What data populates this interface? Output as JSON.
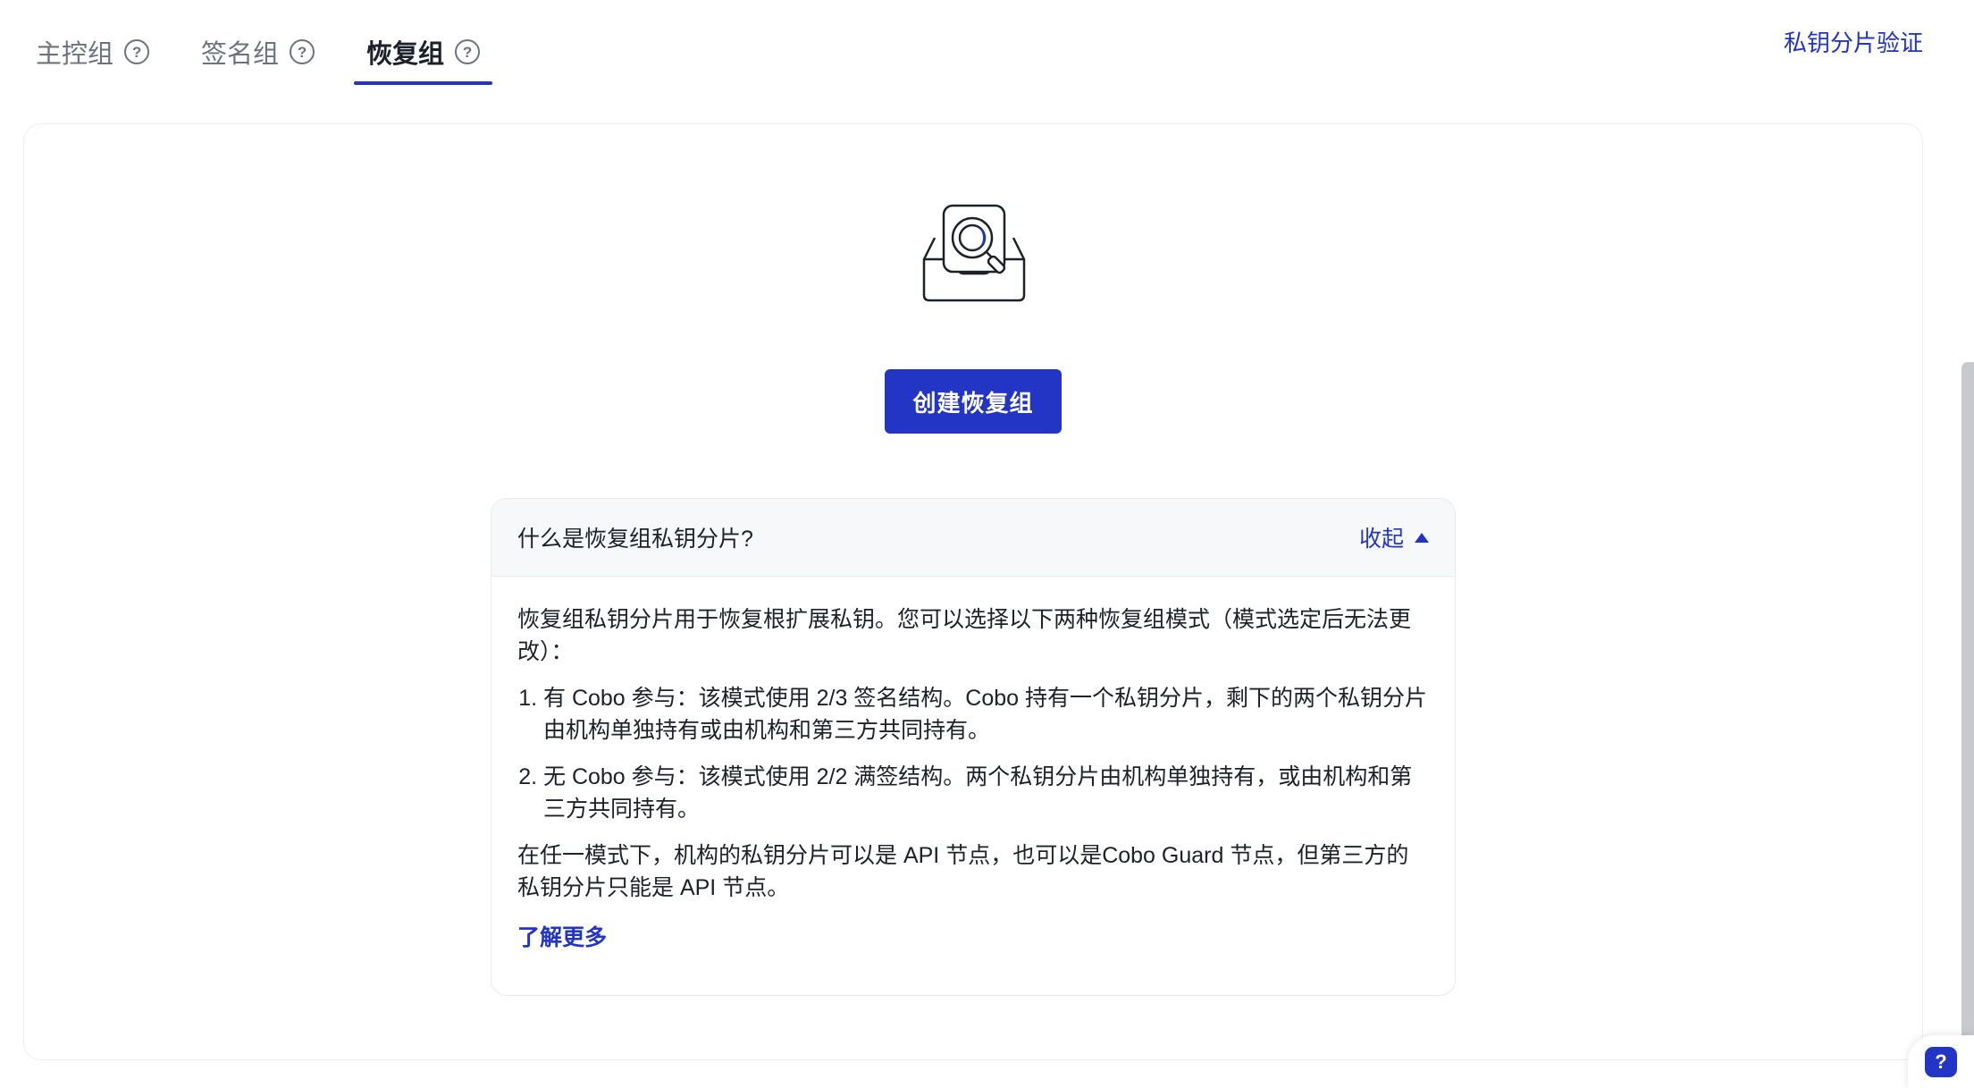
{
  "tabs": [
    {
      "label": "主控组",
      "active": false
    },
    {
      "label": "签名组",
      "active": false
    },
    {
      "label": "恢复组",
      "active": true
    }
  ],
  "help_glyph": "?",
  "top_link": "私钥分片验证",
  "create_button": "创建恢复组",
  "info": {
    "title": "什么是恢复组私钥分片?",
    "collapse_label": "收起",
    "intro": "恢复组私钥分片用于恢复根扩展私钥。您可以选择以下两种恢复组模式（模式选定后无法更改）：",
    "items": [
      "有 Cobo 参与：该模式使用 2/3 签名结构。Cobo 持有一个私钥分片，剩下的两个私钥分片由机构单独持有或由机构和第三方共同持有。",
      "无 Cobo 参与：该模式使用 2/2 满签结构。两个私钥分片由机构单独持有，或由机构和第三方共同持有。"
    ],
    "note": "在任一模式下，机构的私钥分片可以是 API 节点，也可以是Cobo Guard 节点，但第三方的私钥分片只能是 API 节点。",
    "learn_more": "了解更多"
  },
  "colors": {
    "accent": "#2335c4",
    "text": "#1d2129",
    "muted": "#6b7380"
  },
  "icons": {
    "help": "question-circle-icon",
    "illustration": "inbox-search-illustration",
    "collapse": "triangle-up-icon",
    "fab": "help-chat-icon"
  }
}
